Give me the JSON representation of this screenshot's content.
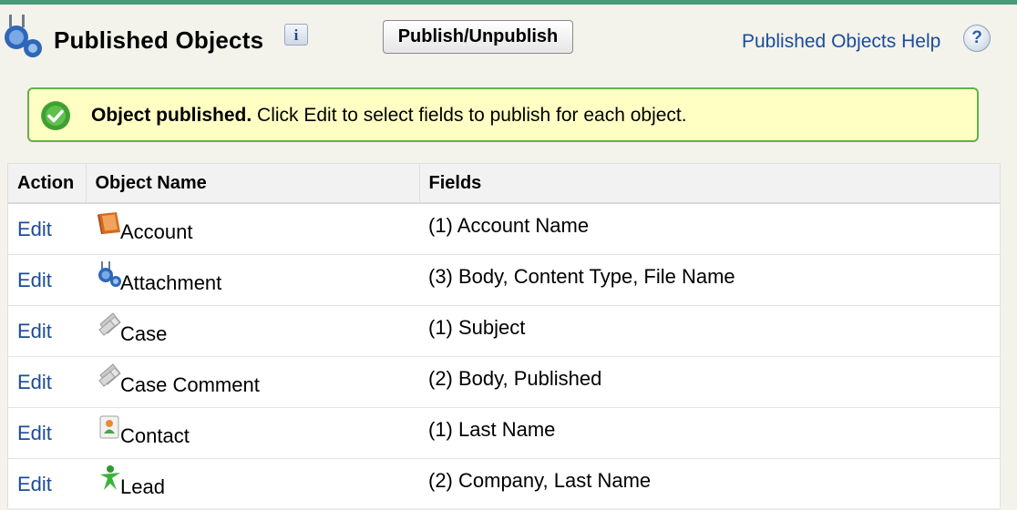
{
  "header": {
    "title": "Published Objects",
    "info_label": "i",
    "publish_button": "Publish/Unpublish",
    "help_link": "Published Objects Help",
    "help_icon_label": "?"
  },
  "message": {
    "strong": "Object published.",
    "text": " Click Edit to select fields to publish for each object."
  },
  "table": {
    "columns": [
      "Action",
      "Object Name",
      "Fields"
    ],
    "rows": [
      {
        "action": "Edit",
        "icon": "account-icon",
        "name": "Account",
        "fields": "(1) Account Name"
      },
      {
        "action": "Edit",
        "icon": "attachment-icon",
        "name": "Attachment",
        "fields": "(3) Body, Content Type, File Name"
      },
      {
        "action": "Edit",
        "icon": "case-icon",
        "name": "Case",
        "fields": "(1) Subject"
      },
      {
        "action": "Edit",
        "icon": "case-comment-icon",
        "name": "Case Comment",
        "fields": "(2) Body, Published"
      },
      {
        "action": "Edit",
        "icon": "contact-icon",
        "name": "Contact",
        "fields": "(1) Last Name"
      },
      {
        "action": "Edit",
        "icon": "lead-icon",
        "name": "Lead",
        "fields": "(2) Company, Last Name"
      }
    ]
  },
  "colors": {
    "accent": "#4a9a78",
    "link": "#1a4c99",
    "success_bg": "#ffffc4",
    "success_border": "#62b14a"
  }
}
